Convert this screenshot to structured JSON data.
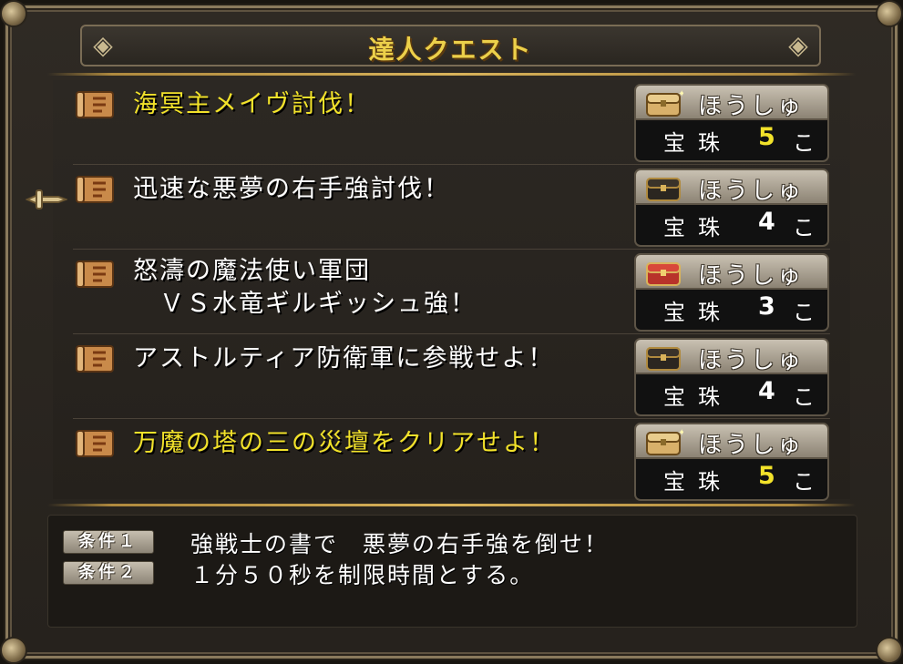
{
  "window": {
    "title": "達人クエスト"
  },
  "quests": [
    {
      "title": "海冥主メイヴ討伐！",
      "highlight": true,
      "reward": {
        "label": "ほうしゅう",
        "chest": "gold-chest-icon",
        "item": "宝珠",
        "count": "5",
        "unit": "こ",
        "count_highlight": true
      }
    },
    {
      "title": "迅速な悪夢の右手強討伐！",
      "highlight": false,
      "selected": true,
      "reward": {
        "label": "ほうしゅう",
        "chest": "black-chest-icon",
        "item": "宝珠",
        "count": "4",
        "unit": "こ",
        "count_highlight": false
      }
    },
    {
      "title": "怒濤の魔法使い軍団\n　ＶＳ水竜ギルギッシュ強！",
      "highlight": false,
      "reward": {
        "label": "ほうしゅう",
        "chest": "red-chest-icon",
        "item": "宝珠",
        "count": "3",
        "unit": "こ",
        "count_highlight": false
      }
    },
    {
      "title": "アストルティア防衛軍に参戦せよ！",
      "highlight": false,
      "reward": {
        "label": "ほうしゅう",
        "chest": "black-chest-icon",
        "item": "宝珠",
        "count": "4",
        "unit": "こ",
        "count_highlight": false
      }
    },
    {
      "title": "万魔の塔の三の災壇をクリアせよ！",
      "highlight": true,
      "reward": {
        "label": "ほうしゅう",
        "chest": "gold-chest-icon",
        "item": "宝珠",
        "count": "5",
        "unit": "こ",
        "count_highlight": true
      }
    }
  ],
  "conditions": [
    {
      "badge": "条件１",
      "text": "強戦士の書で　悪夢の右手強を倒せ！"
    },
    {
      "badge": "条件２",
      "text": "１分５０秒を制限時間とする。"
    }
  ],
  "colors": {
    "highlight": "#f2e22a",
    "text": "#ffffff",
    "frame": "#8a7a5c"
  }
}
